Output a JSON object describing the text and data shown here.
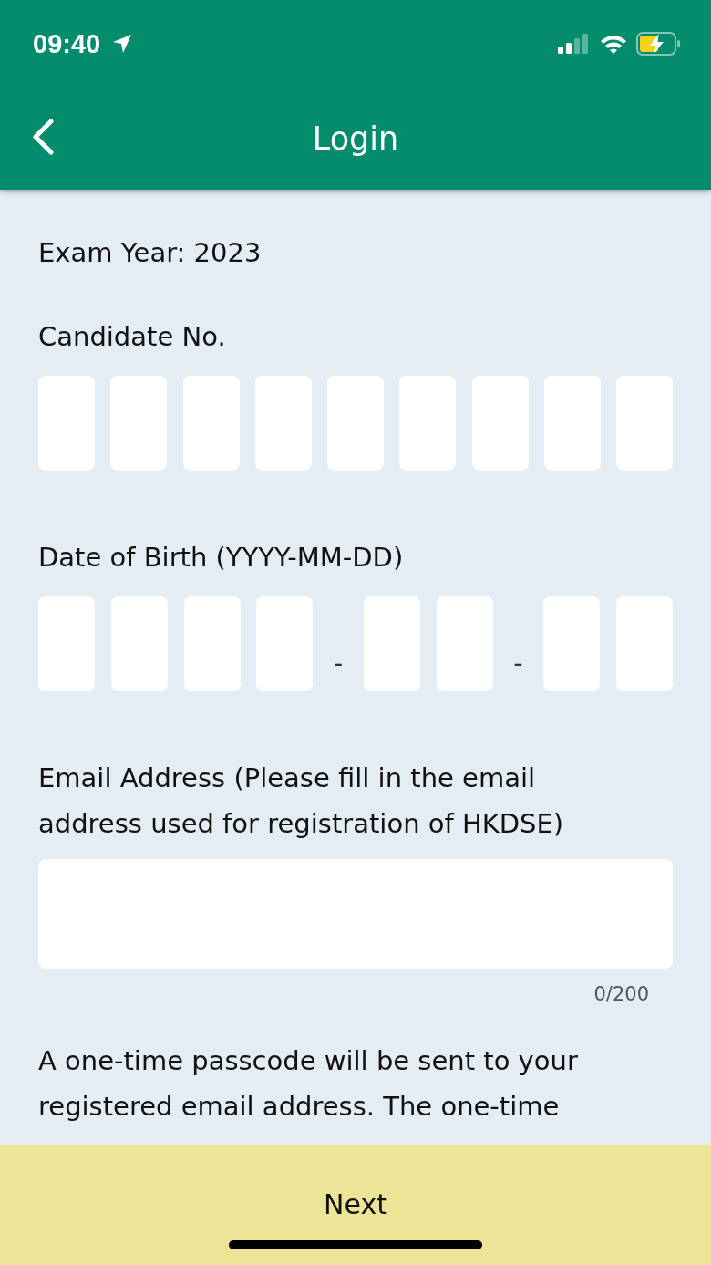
{
  "status_bar": {
    "time": "09:40"
  },
  "header": {
    "title": "Login"
  },
  "exam_year": "Exam Year: 2023",
  "candidate_no": {
    "label": "Candidate No.",
    "fields": [
      {
        "kind": "box"
      },
      {
        "kind": "box"
      },
      {
        "kind": "box"
      },
      {
        "kind": "box"
      },
      {
        "kind": "box"
      },
      {
        "kind": "box"
      },
      {
        "kind": "box"
      },
      {
        "kind": "box"
      },
      {
        "kind": "box"
      }
    ]
  },
  "dob": {
    "label": "Date of Birth (YYYY-MM-DD)",
    "fields": [
      {
        "kind": "box"
      },
      {
        "kind": "box"
      },
      {
        "kind": "box"
      },
      {
        "kind": "box"
      },
      {
        "kind": "separator",
        "text": "-"
      },
      {
        "kind": "box"
      },
      {
        "kind": "box"
      },
      {
        "kind": "separator",
        "text": "-"
      },
      {
        "kind": "box"
      },
      {
        "kind": "box"
      }
    ]
  },
  "email": {
    "label": "Email Address (Please fill in the email address used for registration of HKDSE)",
    "counter": "0/200"
  },
  "notice": "A one-time passcode will be sent to your registered email address. The one-time",
  "next_button": "Next"
}
